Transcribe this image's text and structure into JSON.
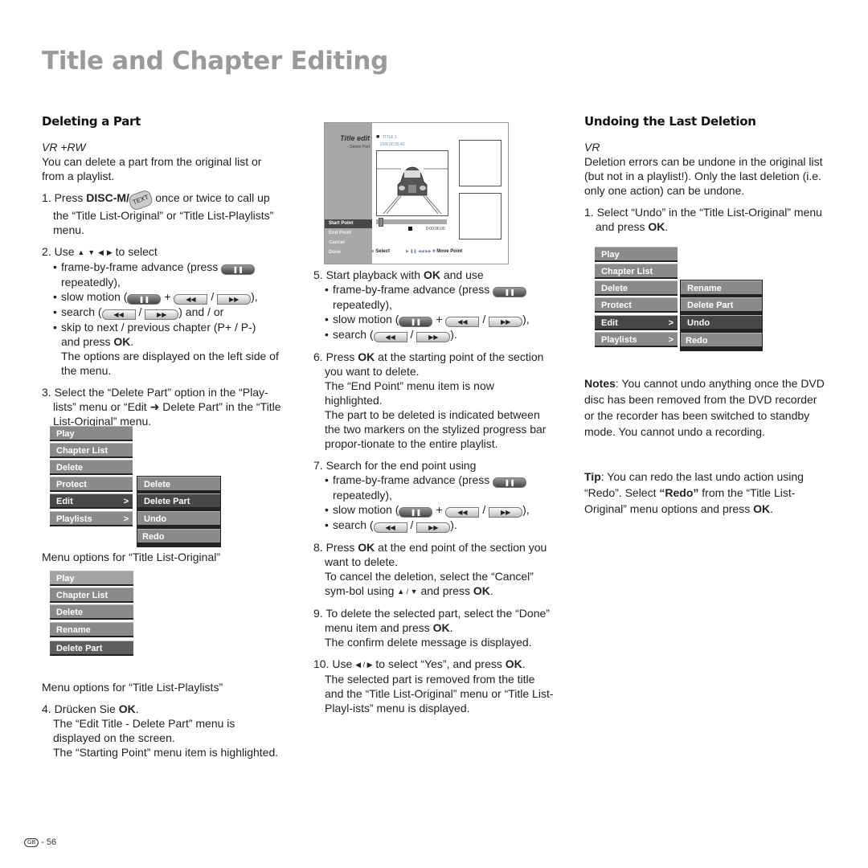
{
  "page": {
    "title": "Title and Chapter Editing",
    "footer": {
      "country_badge": "GB",
      "separator": "-",
      "page_number": "56"
    }
  },
  "left": {
    "heading": "Deleting a Part",
    "modes": "VR +RW",
    "intro": "You can delete a part from the original list or from a playlist.",
    "step1": {
      "num": "1.",
      "pre": "Press ",
      "key": "DISC-M/",
      "key_icon": "TEXT",
      "post": " once or twice to call up the “Title List-Original” or “Title List-Playlists” menu."
    },
    "step2": {
      "num": "2.",
      "pre": "Use",
      "post": "to select",
      "arrows": [
        "▲",
        "▼",
        "◀",
        "▶"
      ],
      "b1_pre": "frame-by-frame advance (press",
      "b1_post": "repeatedly),",
      "b2_pre": "slow motion (",
      "b2_plus": "+",
      "b2_slash": "/",
      "b2_post": "),",
      "b3_pre": "search (",
      "b3_slash": "/",
      "b3_post": ") and / or",
      "b4_a": "skip to next / previous chapter (P+ / P-)",
      "b4_b_pre": "and press ",
      "b4_b_key": "OK",
      "b4_b_post": ".",
      "note": "The options are displayed on the left side of the menu."
    },
    "step3": {
      "num": "3.",
      "text": "Select the “Delete Part” option in the “Play-lists” menu or “Edit ➜ Delete Part” in the “Title List-Original” menu."
    },
    "menu1": {
      "items": [
        "Play",
        "Chapter List",
        "Delete",
        "Protect",
        "Edit",
        "Playlists"
      ],
      "arrow": ">",
      "submenu": [
        "Delete",
        "Delete Part",
        "Undo",
        "Redo"
      ],
      "caption": "Menu options for “Title List-Original”"
    },
    "menu2": {
      "items": [
        "Play",
        "Chapter List",
        "Delete",
        "Rename",
        "Delete Part"
      ],
      "caption": "Menu options for “Title List-Playlists”"
    },
    "step4": {
      "num": "4.",
      "pre": "Drücken Sie ",
      "key": "OK",
      "post": ".",
      "l1": "The “Edit Title - Delete Part” menu is displayed on the screen.",
      "l2": "The “Starting Point” menu item is highlighted."
    }
  },
  "buttons": {
    "pause": "❚❚",
    "rew": "◀◀",
    "ffw": "▶▶"
  },
  "tv": {
    "title": "Title edit",
    "subtitle": "- Delete Part",
    "clip_icon": "clapperboard-icon",
    "clip_title": "TITLE 1",
    "clip_date": "20/8  00:35:42",
    "timecode": "0:00:00.00",
    "options": [
      "Start Point",
      "End Point",
      "Cancel",
      "Done"
    ],
    "hint_select": "Select",
    "hint_controls": "▶ ❚❚ ◀◀ ▶▶",
    "hint_move": "Move Point",
    "progress_fraction": 0.03
  },
  "middle": {
    "step5": {
      "num": "5.",
      "pre": "Start playback with ",
      "key": "OK",
      "post": " and use",
      "b1_pre": "frame-by-frame advance (press",
      "b1_post": "repeatedly),",
      "b2_pre": "slow motion (",
      "b2_plus": "+",
      "b2_slash": "/",
      "b2_post": "),",
      "b3_pre": "search (",
      "b3_slash": "/",
      "b3_post": ")."
    },
    "step6": {
      "num": "6.",
      "pre": "Press ",
      "key": "OK",
      "post": " at the starting point of the section you want to delete.",
      "l1": "The “End Point” menu item is now highlighted.",
      "l2": "The part to be deleted is indicated between the two markers on the stylized progress bar propor-tionate to the entire playlist."
    },
    "step7": {
      "num": "7.",
      "text": "Search for the end point using",
      "b1_pre": "frame-by-frame advance (press",
      "b1_post": "repeatedly),",
      "b2_pre": "slow motion (",
      "b2_plus": "+",
      "b2_slash": "/",
      "b2_post": "),",
      "b3_pre": "search (",
      "b3_slash": "/",
      "b3_post": ")."
    },
    "step8": {
      "num": "8.",
      "pre": "Press ",
      "key": "OK",
      "post": " at the end point of the section you want to delete.",
      "l1_pre": "To cancel the deletion, select the “Cancel” sym-bol using ",
      "l1_arrows": "▲ / ▼",
      "l1_mid": " and press ",
      "l1_key": "OK",
      "l1_post": "."
    },
    "step9": {
      "num": "9.",
      "pre": "To delete the selected part, select the “Done” menu item and press ",
      "key": "OK",
      "post": ".",
      "l1": "The confirm delete message is displayed."
    },
    "step10": {
      "num": "10.",
      "pre": "Use ",
      "arrows": "◀ / ▶",
      "mid": " to select “Yes”, and press ",
      "key": "OK",
      "post": ".",
      "l1": "The selected part is removed from the title and the “Title List-Original” menu or “Title List-Playl-ists” menu is displayed."
    }
  },
  "right": {
    "heading": "Undoing the Last Deletion",
    "modes": "VR",
    "intro": "Deletion errors can be undone in the original list (but not in a playlist!). Only the last deletion (i.e. only one action) can be undone.",
    "step1": {
      "num": "1.",
      "pre": "Select “Undo” in the “Title List-Original” menu and press ",
      "key": "OK",
      "post": "."
    },
    "menu": {
      "items": [
        "Play",
        "Chapter List",
        "Delete",
        "Protect",
        "Edit",
        "Playlists"
      ],
      "arrow": ">",
      "submenu": [
        "Rename",
        "Delete Part",
        "Undo",
        "Redo"
      ]
    },
    "notes": {
      "label": "Notes",
      "text": ": You cannot undo anything once the DVD disc has been removed from the DVD recorder or the recorder has been switched to standby mode. You cannot undo a recording."
    },
    "tip": {
      "label": "Tip",
      "pre": ": You can redo the last undo action using “Redo”. Select ",
      "bold": "“Redo”",
      "post": " from the “Title List-Original” menu options and press ",
      "key": "OK",
      "end": "."
    }
  }
}
